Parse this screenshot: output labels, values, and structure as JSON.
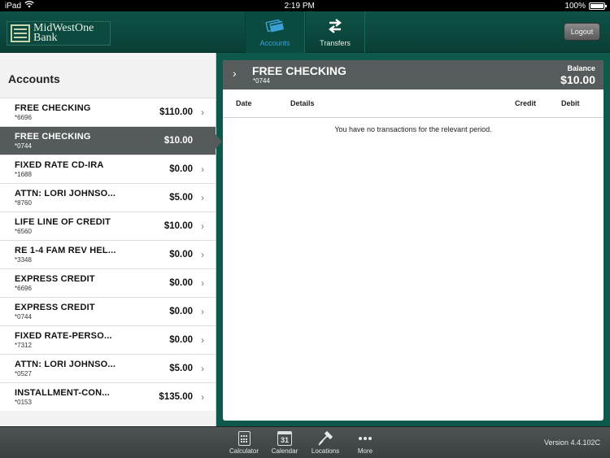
{
  "status_bar": {
    "device": "iPad",
    "time": "2:19 PM",
    "battery": "100%",
    "battery_level": 1.0
  },
  "top_bar": {
    "logo_line1": "MidWestOne",
    "logo_line2": "Bank",
    "tabs": [
      {
        "label": "Accounts",
        "icon": "credit-card-icon",
        "active": true
      },
      {
        "label": "Transfers",
        "icon": "transfer-arrows-icon",
        "active": false
      }
    ],
    "logout_label": "Logout"
  },
  "accounts_panel": {
    "title": "Accounts",
    "items": [
      {
        "name": "FREE CHECKING",
        "number": "*6696",
        "balance": "$110.00"
      },
      {
        "name": "FREE CHECKING",
        "number": "*0744",
        "balance": "$10.00",
        "selected": true
      },
      {
        "name": "FIXED RATE CD-IRA",
        "number": "*1688",
        "balance": "$0.00"
      },
      {
        "name": "ATTN: LORI JOHNSO...",
        "number": "*8760",
        "balance": "$5.00"
      },
      {
        "name": "LIFE LINE OF CREDIT",
        "number": "*6560",
        "balance": "$10.00"
      },
      {
        "name": "RE 1-4 FAM REV HEL...",
        "number": "*3348",
        "balance": "$0.00"
      },
      {
        "name": "EXPRESS CREDIT",
        "number": "*6696",
        "balance": "$0.00"
      },
      {
        "name": "EXPRESS CREDIT",
        "number": "*0744",
        "balance": "$0.00"
      },
      {
        "name": "FIXED RATE-PERSO...",
        "number": "*7312",
        "balance": "$0.00"
      },
      {
        "name": "ATTN: LORI JOHNSO...",
        "number": "*0527",
        "balance": "$5.00"
      },
      {
        "name": "INSTALLMENT-CON...",
        "number": "*0153",
        "balance": "$135.00"
      }
    ]
  },
  "detail": {
    "account_name": "FREE CHECKING",
    "account_number": "*0744",
    "balance_label": "Balance",
    "balance_value": "$10.00",
    "columns": {
      "date": "Date",
      "details": "Details",
      "credit": "Credit",
      "debit": "Debit"
    },
    "empty_message": "You have no transactions for the relevant period."
  },
  "bottom_bar": {
    "items": [
      {
        "label": "Calculator",
        "icon": "calculator-icon"
      },
      {
        "label": "Calendar",
        "icon": "calendar-icon",
        "icon_text": "31"
      },
      {
        "label": "Locations",
        "icon": "locations-icon"
      },
      {
        "label": "More",
        "icon": "more-dots-icon"
      }
    ],
    "version": "Version 4.4.102C"
  }
}
